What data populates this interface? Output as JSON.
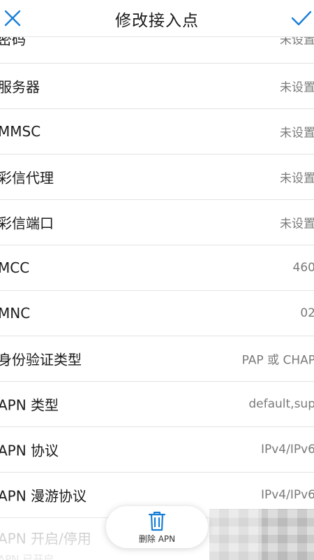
{
  "header": {
    "title": "修改接入点",
    "close_icon": "close-icon",
    "confirm_icon": "check-icon",
    "accent_color": "#1a7ed6"
  },
  "rows": [
    {
      "label": "密码",
      "value": "未设置"
    },
    {
      "label": "服务器",
      "value": "未设置"
    },
    {
      "label": "MMSC",
      "value": "未设置"
    },
    {
      "label": "彩信代理",
      "value": "未设置"
    },
    {
      "label": "彩信端口",
      "value": "未设置"
    },
    {
      "label": "MCC",
      "value": "460"
    },
    {
      "label": "MNC",
      "value": "02"
    },
    {
      "label": "身份验证类型",
      "value": "PAP 或 CHAP"
    },
    {
      "label": "APN 类型",
      "value": "default,sup"
    },
    {
      "label": "APN 协议",
      "value": "IPv4/IPv6"
    },
    {
      "label": "APN 漫游协议",
      "value": "IPv4/IPv6"
    },
    {
      "label": "APN 开启/停用",
      "sub": "APN 已开启"
    }
  ],
  "bottom": {
    "delete_label": "删除 APN",
    "delete_icon": "trash-icon"
  }
}
